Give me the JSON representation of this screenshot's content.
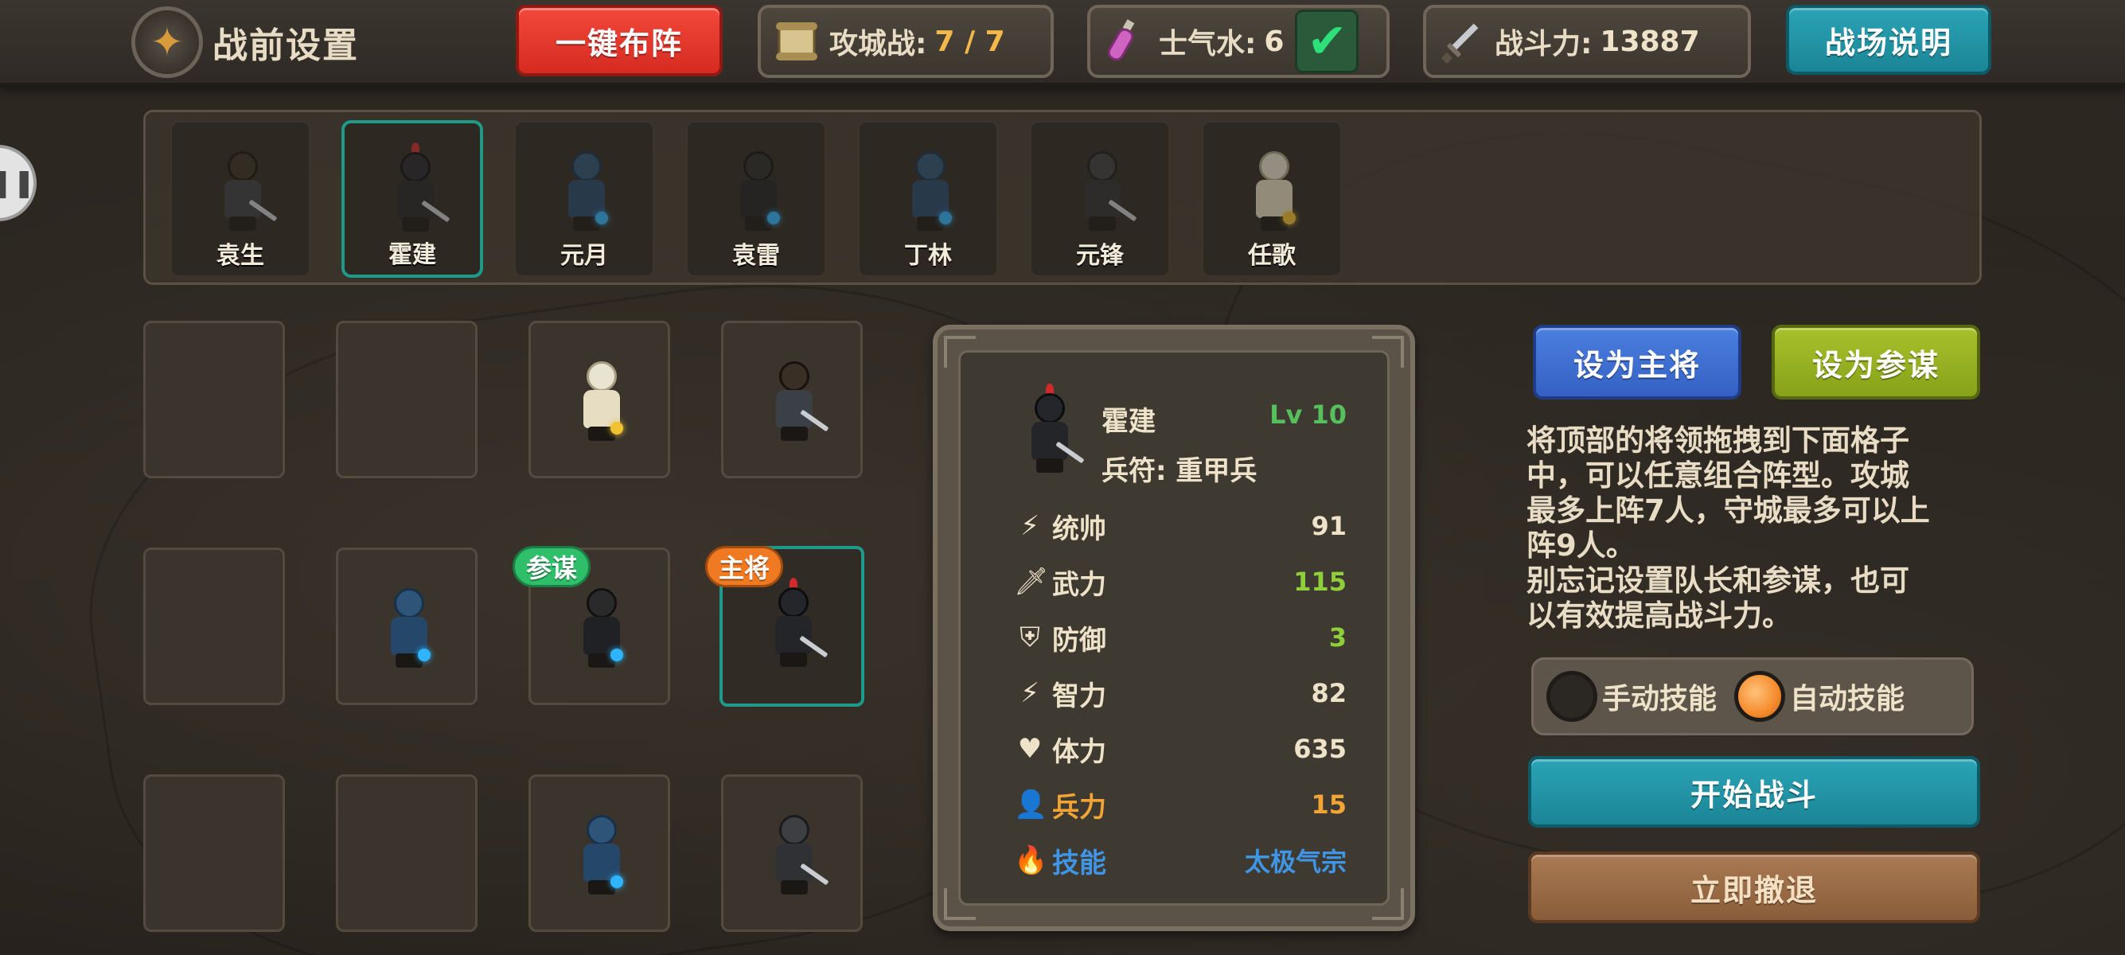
{
  "header": {
    "title": "战前设置",
    "auto_deploy_label": "一键布阵",
    "siege": {
      "label": "攻城战:",
      "value": "7 / 7"
    },
    "morale": {
      "label": "士气水:",
      "value": "6"
    },
    "power": {
      "label": "战斗力:",
      "value": "13887"
    },
    "battle_info_label": "战场说明"
  },
  "roster": [
    {
      "name": "袁生",
      "skin": "dark"
    },
    {
      "name": "霍建",
      "skin": "black",
      "selected": true
    },
    {
      "name": "元月",
      "skin": "hood"
    },
    {
      "name": "袁雷",
      "skin": "blackhood"
    },
    {
      "name": "丁林",
      "skin": "hood"
    },
    {
      "name": "元锋",
      "skin": "grey"
    },
    {
      "name": "任歌",
      "skin": "white"
    }
  ],
  "formation": {
    "advisor_tag": "参谋",
    "commander_tag": "主将"
  },
  "detail": {
    "name": "霍建",
    "level": "Lv 10",
    "troop": "兵符: 重甲兵",
    "stats": [
      {
        "icon": "lightning-icon",
        "label": "统帅",
        "value": "91",
        "color": "#eee2c8"
      },
      {
        "icon": "sword-icon",
        "label": "武力",
        "value": "115",
        "color": "#8fcf3a"
      },
      {
        "icon": "shield-icon",
        "label": "防御",
        "value": "3",
        "color": "#8fcf3a"
      },
      {
        "icon": "lightning-icon",
        "label": "智力",
        "value": "82",
        "color": "#eee2c8"
      },
      {
        "icon": "heart-icon",
        "label": "体力",
        "value": "635",
        "color": "#eee2c8"
      },
      {
        "icon": "person-icon",
        "label": "兵力",
        "value": "15",
        "color": "#f2a535"
      },
      {
        "icon": "flame-icon",
        "label": "技能",
        "value": "太极气宗",
        "color": "#3f95e6"
      }
    ]
  },
  "actions": {
    "set_commander": "设为主将",
    "set_advisor": "设为参谋",
    "help_text": "将顶部的将领拖拽到下面格子\n中，可以任意组合阵型。攻城\n最多上阵7人，守城最多可以上\n阵9人。\n别忘记设置队长和参谋，也可\n以有效提高战斗力。",
    "manual_skill": "手动技能",
    "auto_skill": "自动技能",
    "start_battle": "开始战斗",
    "retreat": "立即撤退"
  },
  "colors": {
    "accent_teal": "#1e9a8a",
    "level_green": "#55c05c",
    "value_gold": "#f2b84a"
  }
}
